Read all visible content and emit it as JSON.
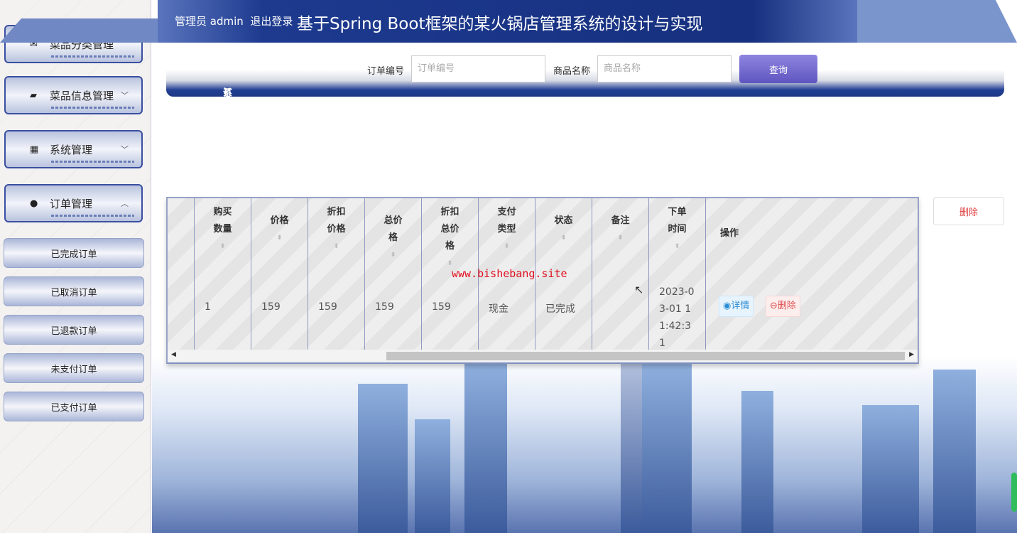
{
  "header": {
    "user_label": "管理员 admin",
    "logout": "退出登录",
    "title": "基于Spring Boot框架的某火锅店管理系统的设计与实现"
  },
  "sidebar": {
    "menus": [
      {
        "label": "菜品分类管理",
        "icon": "category-icon",
        "expanded": false
      },
      {
        "label": "菜品信息管理",
        "icon": "wallet-icon",
        "expanded": false
      },
      {
        "label": "系统管理",
        "icon": "grid-icon",
        "expanded": false
      },
      {
        "label": "订单管理",
        "icon": "bulb-icon",
        "expanded": true
      }
    ],
    "submenu": [
      "已完成订单",
      "已取消订单",
      "已退款订单",
      "未支付订单",
      "已支付订单"
    ]
  },
  "breadcrumb": {
    "home": "系统首页",
    "sep": ">",
    "current": "订单管理"
  },
  "search": {
    "order_no_label": "订单编号",
    "order_no_placeholder": "订单编号",
    "product_label": "商品名称",
    "product_placeholder": "商品名称",
    "query": "查询"
  },
  "toolbar": {
    "delete": "删除"
  },
  "table": {
    "headers": [
      "购买数量",
      "价格",
      "折扣价格",
      "总价格",
      "折扣总价格",
      "支付类型",
      "状态",
      "备注",
      "下单时间",
      "操作"
    ],
    "rows": [
      {
        "qty": "1",
        "price": "159",
        "discount_price": "159",
        "total": "159",
        "discount_total": "159",
        "pay_type": "现金",
        "status": "已完成",
        "note": "",
        "time": "2023-03-01 11:42:31"
      }
    ],
    "detail": "详情",
    "delete": "删除"
  },
  "watermark": "www.bishebang.site"
}
